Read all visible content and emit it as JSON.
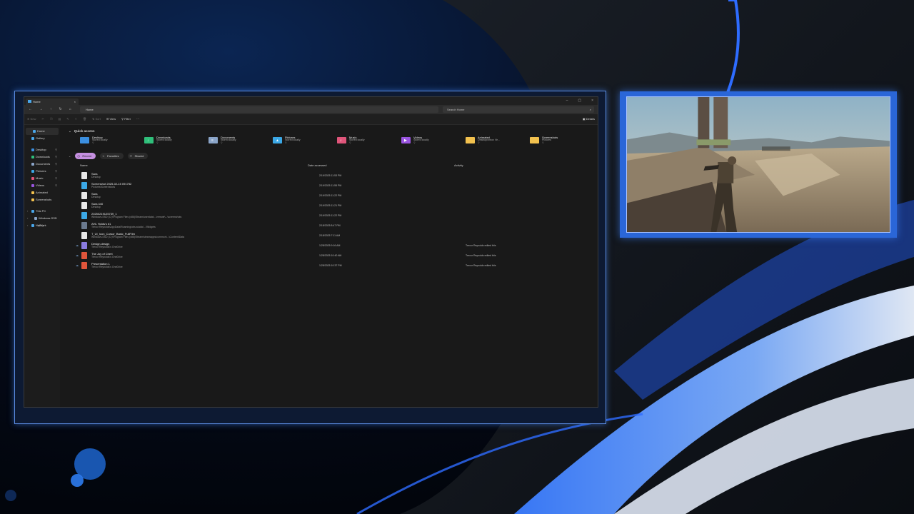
{
  "theme": {
    "accent": "#2a66d8",
    "explorer_bg": "#191919",
    "sidebar_bg": "#1c1c1c",
    "recent_pill": "#c58fe0",
    "folder_yellow": "#f2c14e"
  },
  "explorer": {
    "tab_title": "Home",
    "address": "Home",
    "search_placeholder": "Search Home",
    "commands": {
      "new": "New",
      "sort": "Sort",
      "view": "View",
      "filter": "Filter",
      "more": "···",
      "details": "Details"
    },
    "sidebar": {
      "top": [
        {
          "label": "Home",
          "icon": "home-icon",
          "color": "#4aa7ea",
          "selected": true
        },
        {
          "label": "Gallery",
          "icon": "gallery-icon",
          "color": "#4aa7ea"
        }
      ],
      "pinned": [
        {
          "label": "Desktop",
          "icon": "desktop-icon",
          "color": "#3b8fe0"
        },
        {
          "label": "Downloads",
          "icon": "downloads-icon",
          "color": "#2fbf7a"
        },
        {
          "label": "Documents",
          "icon": "documents-icon",
          "color": "#8aa4c8"
        },
        {
          "label": "Pictures",
          "icon": "pictures-icon",
          "color": "#3ba8e6"
        },
        {
          "label": "Music",
          "icon": "music-icon",
          "color": "#e0557a"
        },
        {
          "label": "Videos",
          "icon": "videos-icon",
          "color": "#9a55e0"
        },
        {
          "label": "Animated",
          "icon": "folder-icon",
          "color": "#f2c14e"
        },
        {
          "label": "Screenshots",
          "icon": "folder-icon",
          "color": "#f2c14e"
        }
      ],
      "devices": [
        {
          "label": "This PC",
          "icon": "pc-icon",
          "color": "#4aa7ea"
        },
        {
          "label": "Windows-SSD (C:)",
          "icon": "drive-icon",
          "color": "#8aa4c8"
        },
        {
          "label": "Network",
          "icon": "network-icon",
          "color": "#4aa7ea"
        }
      ]
    },
    "quick_access": {
      "header": "Quick access",
      "items": [
        {
          "name": "Desktop",
          "sub": "Stored locally",
          "color": "#3b8fe0",
          "glyph": ""
        },
        {
          "name": "Downloads",
          "sub": "Stored locally",
          "color": "#2fbf7a",
          "glyph": "↓"
        },
        {
          "name": "Documents",
          "sub": "Stored locally",
          "color": "#8aa4c8",
          "glyph": "≡"
        },
        {
          "name": "Pictures",
          "sub": "Stored locally",
          "color": "#3ba8e6",
          "glyph": "▲"
        },
        {
          "name": "Music",
          "sub": "Stored locally",
          "color": "#e0557a",
          "glyph": "♪"
        },
        {
          "name": "Videos",
          "sub": "Stored locally",
          "color": "#9a55e0",
          "glyph": "▶"
        },
        {
          "name": "Animated",
          "sub": "Desktop\\Inbox Ve...",
          "color": "#f2c14e",
          "glyph": ""
        },
        {
          "name": "Screenshots",
          "sub": "Pictures",
          "color": "#f2c14e",
          "glyph": ""
        }
      ]
    },
    "tabs": [
      {
        "label": "Recent",
        "icon": "clock-icon",
        "active": true
      },
      {
        "label": "Favorites",
        "icon": "star-icon",
        "active": false
      },
      {
        "label": "Shared",
        "icon": "shared-icon",
        "active": false
      }
    ],
    "columns": {
      "name": "Name",
      "date": "Date accessed",
      "activity": "Activity"
    },
    "files": [
      {
        "name": "Sara",
        "location": "Desktop",
        "date": "2/19/2025 11:53 PM",
        "activity": "",
        "cloud": false,
        "icon_color": "#e8e8e8"
      },
      {
        "name": "Screenshot 2025-02-15 091752",
        "location": "Pictures\\Screenshots",
        "date": "2/19/2025 11:55 PM",
        "activity": "",
        "cloud": false,
        "icon_color": "#3ba8e6"
      },
      {
        "name": "Sara",
        "location": "Desktop",
        "date": "2/19/2025 11:22 PM",
        "activity": "",
        "cloud": false,
        "icon_color": "#e8e8e8"
      },
      {
        "name": "Sara 440",
        "location": "Desktop",
        "date": "2/19/2025 11:21 PM",
        "activity": "",
        "cloud": false,
        "icon_color": "#e8e8e8"
      },
      {
        "name": "20250219125739_1",
        "location": "Windows-SSD (C:)\\Program Files (x86)\\Steam\\userdata\\...\\remote\\...\\screenshots",
        "date": "2/19/2025 11:22 PM",
        "activity": "",
        "cloud": false,
        "icon_color": "#3ba8e6"
      },
      {
        "name": "AHL Holds's #1",
        "location": "Trevor Reynolds\\AppData\\Roaming\\obs-studio\\...\\Widgets",
        "date": "2/18/2025 8:47 PM",
        "activity": "",
        "cloud": false,
        "icon_color": "#6b7a8f"
      },
      {
        "name": "T_UI_Icon_Cursor_Basic_FullFilm",
        "location": "Windows-SSD (C:)\\Program Files (x86)\\Steam\\steamapps\\common\\...\\Content\\Data",
        "date": "2/18/2025 7:11 AM",
        "activity": "",
        "cloud": false,
        "icon_color": "#e8e8e8"
      },
      {
        "name": "Design.design",
        "location": "Trevor Reynolds's OneDrive",
        "date": "1/28/2025 9:16 AM",
        "activity": "Trevor Reynolds edited this",
        "cloud": true,
        "icon_color": "#8a7be0"
      },
      {
        "name": "The Joy of Chert",
        "location": "Trevor Reynolds's OneDrive",
        "date": "1/28/2025 10:40 AM",
        "activity": "Trevor Reynolds edited this",
        "cloud": true,
        "icon_color": "#e0553b"
      },
      {
        "name": "Presentation 1",
        "location": "Trevor Reynolds's OneDrive",
        "date": "1/28/2025 10:37 PM",
        "activity": "Trevor Reynolds edited this",
        "cloud": true,
        "icon_color": "#e0553b"
      }
    ]
  }
}
